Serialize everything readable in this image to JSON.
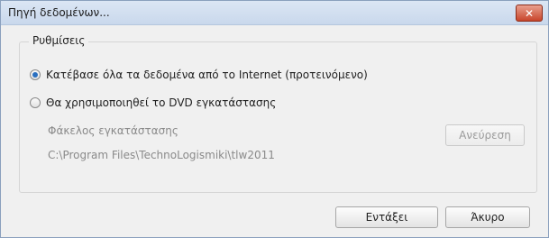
{
  "window": {
    "title": "Πηγή δεδομένων...",
    "close_glyph": "✕"
  },
  "settings_group": {
    "label": "Ρυθμίσεις",
    "options": [
      {
        "label": "Κατέβασε όλα τα δεδομένα από το Internet (προτεινόμενο)",
        "checked": true
      },
      {
        "label": "Θα χρησιμοποιηθεί το DVD εγκατάστασης",
        "checked": false
      }
    ],
    "folder_label": "Φάκελος εγκατάστασης",
    "folder_path": "C:\\Program Files\\TechnoLogismiki\\tlw2011",
    "browse_label": "Ανεύρεση"
  },
  "footer": {
    "ok_label": "Εντάξει",
    "cancel_label": "Άκυρο"
  }
}
